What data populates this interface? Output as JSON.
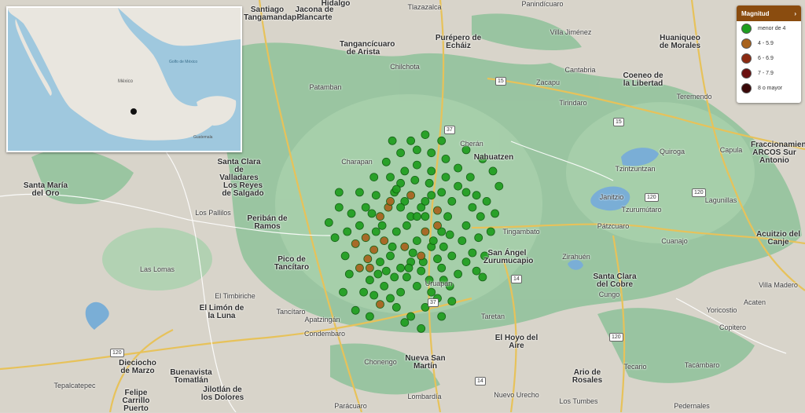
{
  "legend": {
    "title": "Magnitud",
    "toggle_icon": "chevron-right-icon",
    "items": [
      {
        "label": "menor de 4",
        "color": "#1f9e1f"
      },
      {
        "label": "4 - 5.9",
        "color": "#a8621d"
      },
      {
        "label": "6 - 6.9",
        "color": "#8b2a12"
      },
      {
        "label": "7 - 7.9",
        "color": "#6a1010"
      },
      {
        "label": "8 o mayor",
        "color": "#3a0808"
      }
    ]
  },
  "inset": {
    "labels": [
      "México",
      "Golfo de México",
      "Guatemala"
    ]
  },
  "places": [
    "Santiago Tangamandapio",
    "Jacona de Plancarte",
    "Hidalgo",
    "Tlazazalca",
    "Tangancícuaro de Arista",
    "Purépero de Echáiz",
    "Villa Jiménez",
    "Panindícuaro",
    "Huaniqueo de Morales",
    "Chilchota",
    "Cantabria",
    "Zacapu",
    "Coeneo de la Libertad",
    "Tirindaro",
    "Teremendo",
    "Patamban",
    "Cherán",
    "Nahuatzen",
    "Quiroga",
    "Capula",
    "Fraccionamiento ARCOS Sur Antonio",
    "Santa Clara de Valladares",
    "Charapan",
    "Tzintzuntzan",
    "Santa María del Oro",
    "Los Reyes de Salgado",
    "Janitzio",
    "Tzurumútaro",
    "Lagunillas",
    "Los Pallilos",
    "Peribán de Ramos",
    "Tingambato",
    "Pátzcuaro",
    "Acuitzio del Canje",
    "Cuanajo",
    "Las Lomas",
    "Pico de Tancítaro",
    "San Ángel Zurumucapio",
    "Zirahuén",
    "Santa Clara del Cobre",
    "Villa Madero",
    "Uruapan",
    "El Timbiriche",
    "El Limón de la Luna",
    "Tancítaro",
    "Apatzingán",
    "Taretan",
    "Cungo",
    "Acaten",
    "Yoricostio",
    "Copitero",
    "Condembaro",
    "El Hoyo del Aire",
    "Tecario",
    "Tacámbaro",
    "Ario de Rosales",
    "Dieciocho de Marzo",
    "Buenavista Tomatlán",
    "Chonengo",
    "Nueva San Martín",
    "Tepalcatepec",
    "Felipe Carrillo Puerto",
    "Jilotlán de los Dolores",
    "Lombardía",
    "Parácuaro",
    "Nuevo Urecho",
    "Los Tumbes",
    "Pedernales"
  ],
  "roads": [
    "15",
    "37",
    "120",
    "14",
    "120",
    "37",
    "120",
    "14",
    "15",
    "120"
  ],
  "quake_points_lonlat_note": "",
  "quakes": [
    [
      -102.23,
      19.63,
      0
    ],
    [
      -102.2,
      19.66,
      0
    ],
    [
      -102.18,
      19.6,
      0
    ],
    [
      -102.26,
      19.58,
      1
    ],
    [
      -102.3,
      19.55,
      1
    ],
    [
      -102.15,
      19.55,
      0
    ],
    [
      -102.1,
      19.58,
      0
    ],
    [
      -102.05,
      19.62,
      0
    ],
    [
      -102.02,
      19.57,
      1
    ],
    [
      -102.08,
      19.5,
      1
    ],
    [
      -102.12,
      19.47,
      0
    ],
    [
      -102.18,
      19.45,
      1
    ],
    [
      -102.22,
      19.5,
      0
    ],
    [
      -102.28,
      19.47,
      1
    ],
    [
      -102.33,
      19.44,
      1
    ],
    [
      -102.36,
      19.41,
      1
    ],
    [
      -102.3,
      19.4,
      0
    ],
    [
      -102.25,
      19.42,
      0
    ],
    [
      -102.2,
      19.38,
      0
    ],
    [
      -102.15,
      19.4,
      0
    ],
    [
      -102.1,
      19.42,
      1
    ],
    [
      -102.05,
      19.45,
      0
    ],
    [
      -102.0,
      19.5,
      0
    ],
    [
      -101.97,
      19.55,
      0
    ],
    [
      -101.95,
      19.6,
      0
    ],
    [
      -101.92,
      19.65,
      0
    ],
    [
      -101.98,
      19.68,
      0
    ],
    [
      -102.05,
      19.7,
      0
    ],
    [
      -102.12,
      19.72,
      0
    ],
    [
      -102.18,
      19.7,
      0
    ],
    [
      -102.25,
      19.68,
      0
    ],
    [
      -102.32,
      19.62,
      0
    ],
    [
      -102.37,
      19.58,
      0
    ],
    [
      -102.4,
      19.52,
      0
    ],
    [
      -102.42,
      19.46,
      1
    ],
    [
      -102.4,
      19.38,
      1
    ],
    [
      -102.35,
      19.34,
      0
    ],
    [
      -102.28,
      19.32,
      0
    ],
    [
      -102.2,
      19.3,
      0
    ],
    [
      -102.12,
      19.32,
      0
    ],
    [
      -102.06,
      19.34,
      0
    ],
    [
      -102.0,
      19.38,
      0
    ],
    [
      -101.95,
      19.42,
      0
    ],
    [
      -101.9,
      19.47,
      0
    ],
    [
      -101.88,
      19.52,
      0
    ],
    [
      -101.85,
      19.58,
      0
    ],
    [
      -101.88,
      19.63,
      0
    ],
    [
      -102.15,
      19.62,
      1
    ],
    [
      -102.08,
      19.55,
      0
    ],
    [
      -102.02,
      19.52,
      1
    ],
    [
      -102.25,
      19.6,
      1
    ],
    [
      -102.32,
      19.5,
      0
    ],
    [
      -102.37,
      19.48,
      1
    ],
    [
      -102.27,
      19.37,
      0
    ],
    [
      -102.17,
      19.35,
      0
    ],
    [
      -102.1,
      19.37,
      0
    ],
    [
      -102.22,
      19.25,
      0
    ],
    [
      -102.15,
      19.22,
      0
    ],
    [
      -102.08,
      19.25,
      0
    ],
    [
      -102.02,
      19.28,
      0
    ],
    [
      -101.96,
      19.32,
      0
    ],
    [
      -101.92,
      19.36,
      0
    ],
    [
      -101.88,
      19.4,
      0
    ],
    [
      -102.3,
      19.26,
      1
    ],
    [
      -102.38,
      19.3,
      0
    ],
    [
      -102.45,
      19.36,
      0
    ],
    [
      -102.47,
      19.42,
      0
    ],
    [
      -102.46,
      19.5,
      0
    ],
    [
      -102.44,
      19.56,
      0
    ],
    [
      -102.4,
      19.63,
      0
    ],
    [
      -102.33,
      19.68,
      0
    ],
    [
      -102.27,
      19.73,
      0
    ],
    [
      -102.2,
      19.76,
      0
    ],
    [
      -102.12,
      19.77,
      0
    ],
    [
      -102.05,
      19.76,
      0
    ],
    [
      -101.98,
      19.74,
      0
    ],
    [
      -101.92,
      19.71,
      0
    ],
    [
      -101.86,
      19.68,
      0
    ],
    [
      -101.83,
      19.62,
      0
    ],
    [
      -101.81,
      19.55,
      0
    ],
    [
      -101.82,
      19.48,
      0
    ],
    [
      -101.85,
      19.43,
      0
    ],
    [
      -101.83,
      19.37,
      0
    ],
    [
      -102.18,
      19.2,
      0
    ],
    [
      -102.1,
      19.18,
      0
    ],
    [
      -102.12,
      19.55,
      0
    ],
    [
      -102.17,
      19.52,
      0
    ],
    [
      -102.2,
      19.58,
      0
    ],
    [
      -102.08,
      19.6,
      0
    ],
    [
      -102.04,
      19.47,
      0
    ],
    [
      -101.99,
      19.45,
      0
    ],
    [
      -102.14,
      19.43,
      0
    ],
    [
      -102.24,
      19.45,
      0
    ],
    [
      -102.29,
      19.52,
      0
    ],
    [
      -102.34,
      19.56,
      0
    ],
    [
      -102.22,
      19.64,
      0
    ],
    [
      -102.13,
      19.67,
      0
    ],
    [
      -102.06,
      19.66,
      0
    ],
    [
      -102.0,
      19.63,
      0
    ],
    [
      -101.96,
      19.49,
      0
    ],
    [
      -102.02,
      19.41,
      0
    ],
    [
      -102.09,
      19.4,
      0
    ],
    [
      -102.16,
      19.38,
      0
    ],
    [
      -102.23,
      19.35,
      0
    ],
    [
      -102.31,
      19.36,
      0
    ],
    [
      -102.35,
      19.38,
      1
    ],
    [
      -102.33,
      19.29,
      0
    ],
    [
      -102.25,
      19.28,
      0
    ],
    [
      -102.05,
      19.3,
      0
    ],
    [
      -101.99,
      19.34,
      0
    ],
    [
      -101.78,
      19.6,
      0
    ],
    [
      -101.76,
      19.5,
      0
    ],
    [
      -101.79,
      19.42,
      0
    ],
    [
      -101.8,
      19.35,
      0
    ],
    [
      -102.5,
      19.58,
      0
    ],
    [
      -102.52,
      19.48,
      0
    ],
    [
      -102.48,
      19.3,
      0
    ],
    [
      -102.42,
      19.24,
      0
    ],
    [
      -102.35,
      19.22,
      0
    ],
    [
      -102.0,
      19.22,
      0
    ],
    [
      -101.95,
      19.27,
      0
    ],
    [
      -101.74,
      19.56,
      0
    ],
    [
      -101.72,
      19.65,
      0
    ],
    [
      -101.75,
      19.7,
      0
    ],
    [
      -101.8,
      19.74,
      0
    ],
    [
      -101.88,
      19.77,
      0
    ],
    [
      -102.0,
      19.8,
      0
    ],
    [
      -102.08,
      19.82,
      0
    ],
    [
      -102.15,
      19.8,
      0
    ],
    [
      -102.24,
      19.8,
      0
    ],
    [
      -102.55,
      19.53,
      0
    ],
    [
      -102.5,
      19.63,
      0
    ]
  ]
}
